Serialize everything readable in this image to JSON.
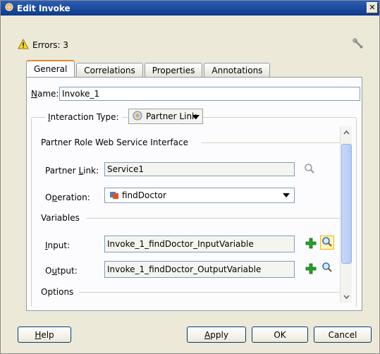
{
  "window": {
    "title": "Edit Invoke",
    "close_glyph": "✕"
  },
  "errors": {
    "text": "Errors: 3"
  },
  "tabs": [
    {
      "label": "General",
      "active": true
    },
    {
      "label": "Correlations",
      "active": false
    },
    {
      "label": "Properties",
      "active": false
    },
    {
      "label": "Annotations",
      "active": false
    }
  ],
  "form": {
    "name_label_mnemonic": "N",
    "name_label_rest": "ame:",
    "name_value": "Invoke_1",
    "interaction_label_mnemonic": "I",
    "interaction_label_rest": "nteraction Type:",
    "interaction_value": "Partner Link",
    "partner_role_heading": "Partner Role Web Service Interface",
    "partner_link_label_a": "Partner ",
    "partner_link_label_mnemonic": "L",
    "partner_link_label_b": "ink:",
    "partner_link_value": "Service1",
    "operation_label_a": "O",
    "operation_label_mnemonic": "p",
    "operation_label_b": "eration:",
    "operation_value": "findDoctor",
    "variables_heading": "Variables",
    "input_label_mnemonic": "I",
    "input_label_rest": "nput:",
    "input_value": "Invoke_1_findDoctor_InputVariable",
    "output_label_a": "O",
    "output_label_mnemonic": "u",
    "output_label_b": "tput:",
    "output_value": "Invoke_1_findDoctor_OutputVariable",
    "options_heading": "Options"
  },
  "buttons": {
    "help_mnemonic": "H",
    "help_rest": "elp",
    "apply_mnemonic": "A",
    "apply_rest": "pply",
    "ok": "OK",
    "cancel": "Cancel"
  },
  "colors": {
    "title_bar": "#0f3a8a",
    "dialog_bg": "#ece9d8",
    "tab_accent": "#e68b2c",
    "add_icon": "#22a322",
    "focus_highlight": "#f7b500"
  }
}
